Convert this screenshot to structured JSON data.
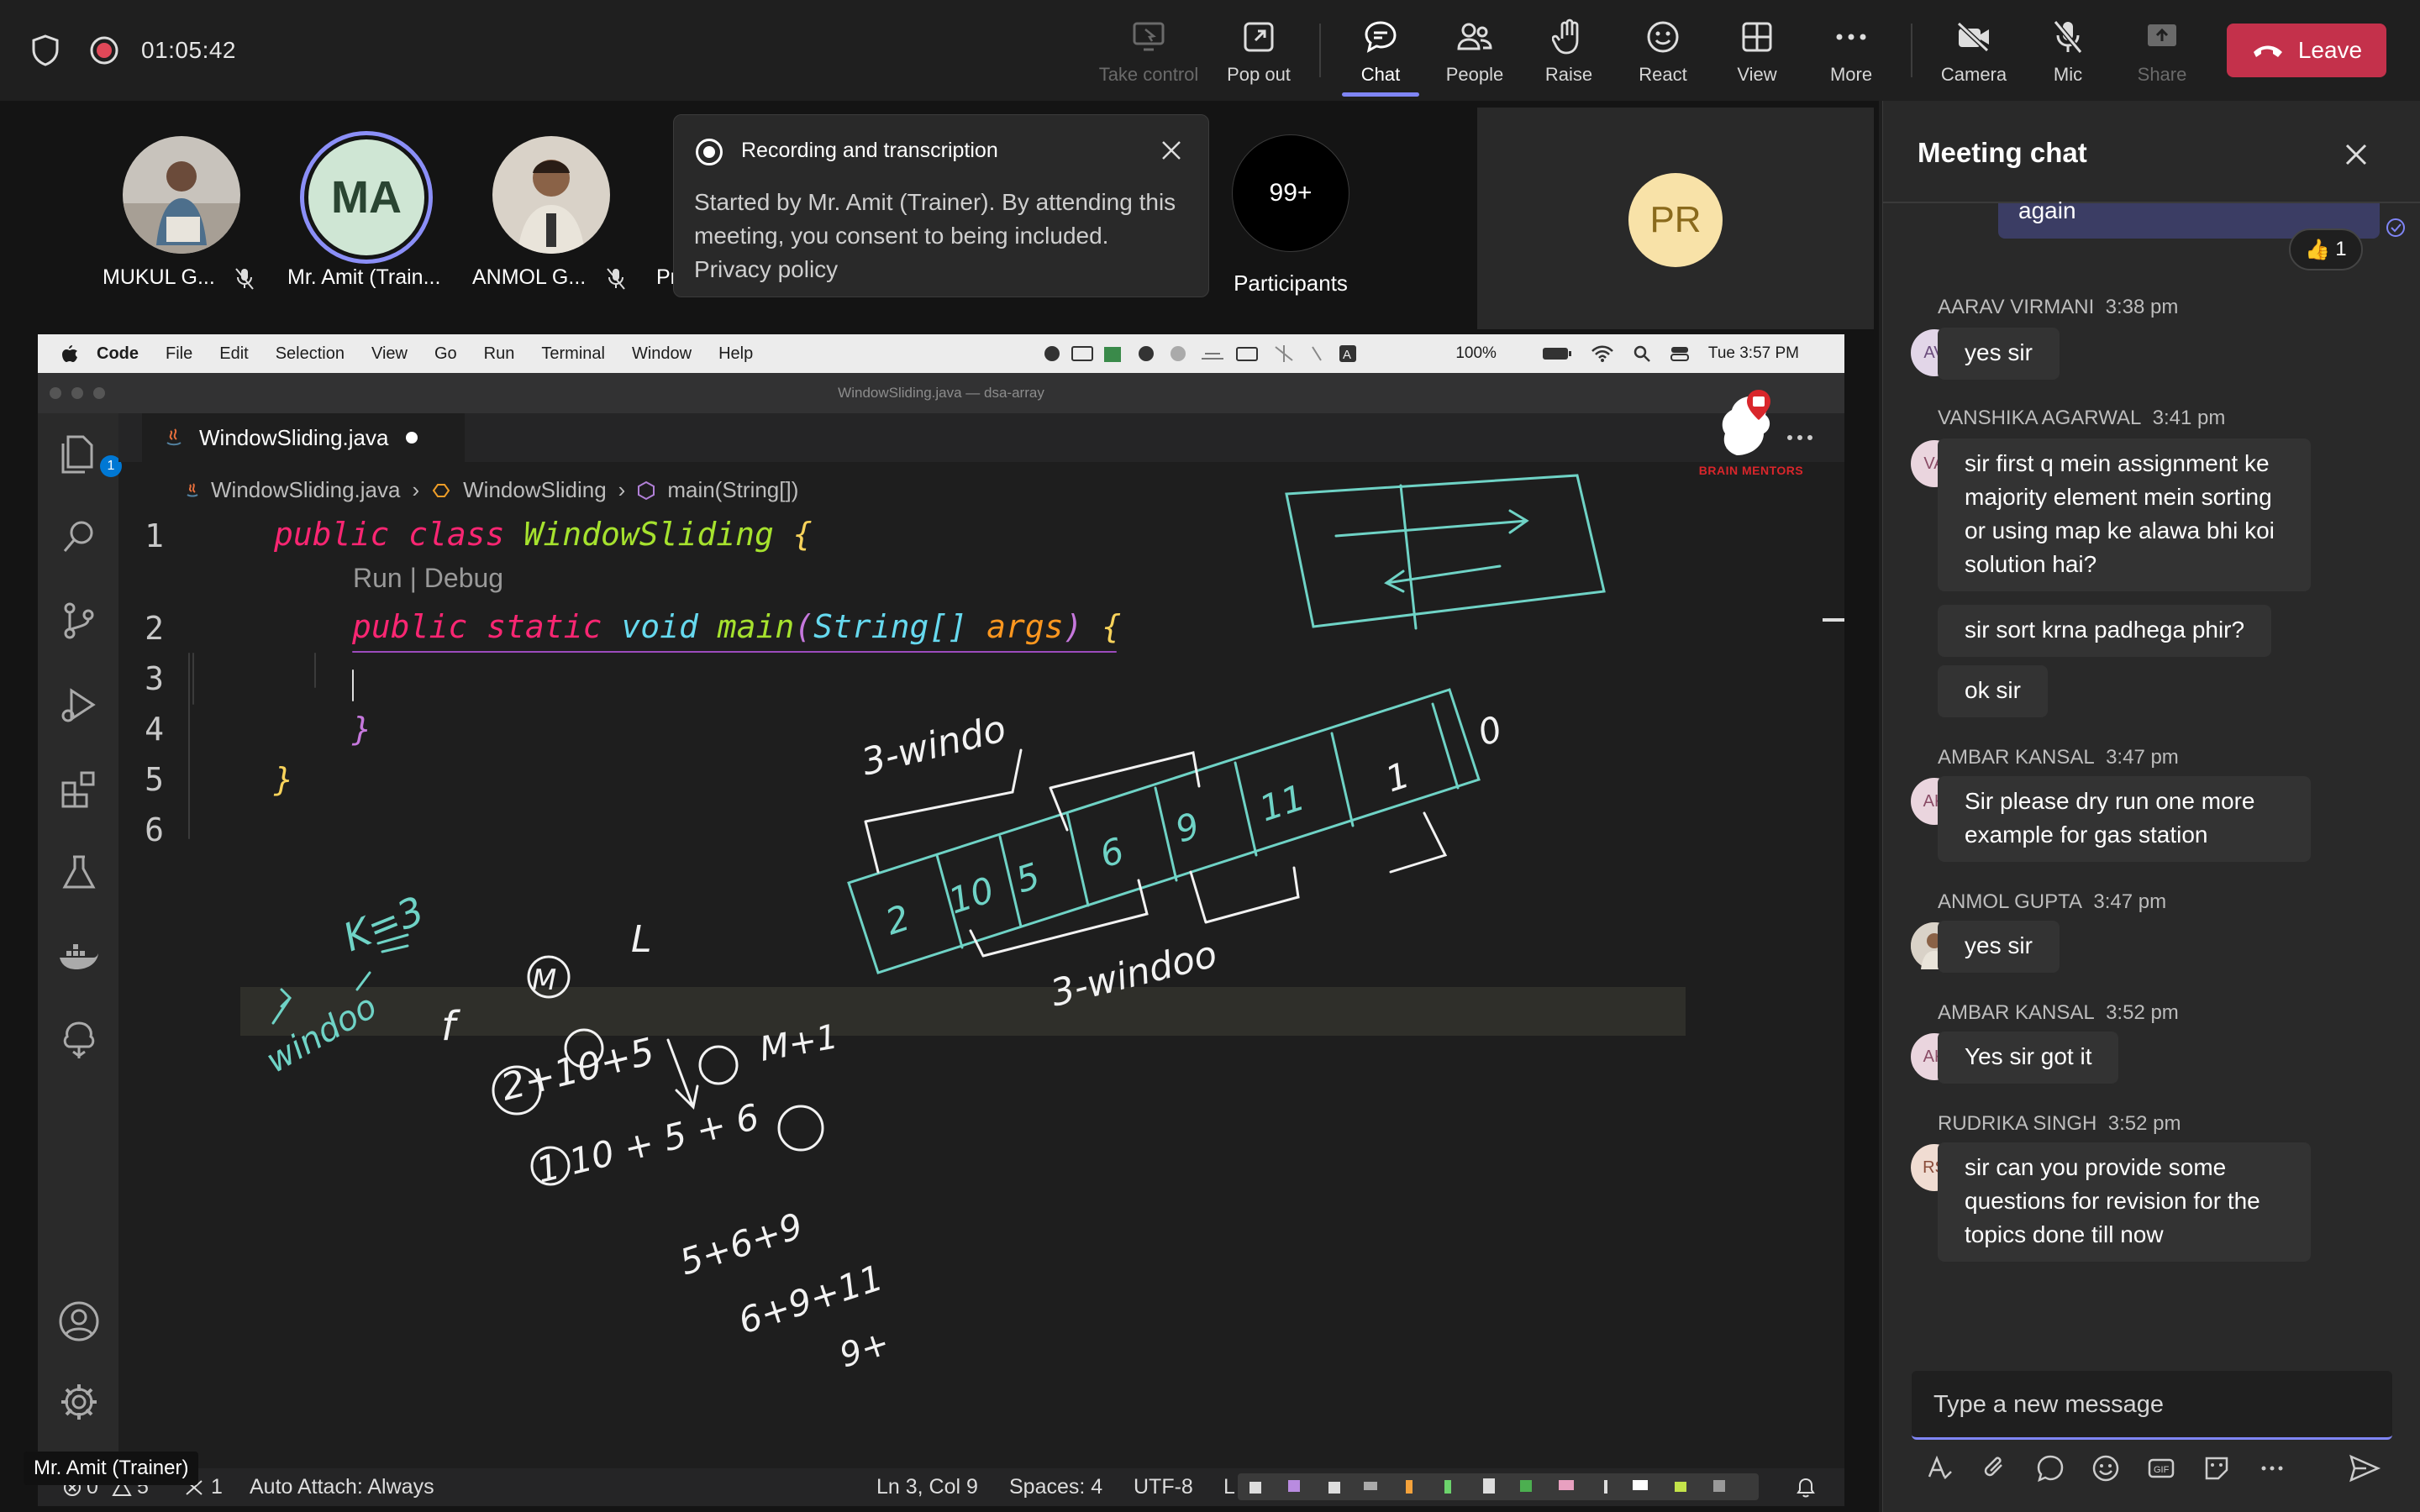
{
  "top_bar": {
    "timer": "01:05:42",
    "buttons": {
      "take_control": "Take control",
      "pop_out": "Pop out",
      "chat": "Chat",
      "people": "People",
      "raise": "Raise",
      "react": "React",
      "view": "View",
      "more": "More",
      "camera": "Camera",
      "mic": "Mic",
      "share": "Share"
    },
    "leave": "Leave"
  },
  "gallery": {
    "participants": [
      {
        "name": "MUKUL G...",
        "muted": true
      },
      {
        "name": "Mr. Amit (Train...",
        "initials": "MA",
        "muted": false
      },
      {
        "name": "ANMOL G...",
        "muted": true
      },
      {
        "name": "Pr"
      }
    ],
    "count": "99+",
    "count_label": "Participants",
    "pr_initials": "PR"
  },
  "toast": {
    "title": "Recording and transcription",
    "body": "Started by Mr. Amit (Trainer). By attending this meeting, you consent to being included.",
    "link": "Privacy policy"
  },
  "shared_screen": {
    "mac_menu": [
      "Code",
      "File",
      "Edit",
      "Selection",
      "View",
      "Go",
      "Run",
      "Terminal",
      "Window",
      "Help"
    ],
    "mac_battery": "100%",
    "mac_clock": "Tue 3:57 PM",
    "window_title": "WindowSliding.java — dsa-array",
    "tab_name": "WindowSliding.java",
    "breadcrumb": [
      "WindowSliding.java",
      "WindowSliding",
      "main(String[])"
    ],
    "brand": "BRAIN MENTORS",
    "line_numbers": [
      "1",
      "2",
      "3",
      "4",
      "5",
      "6"
    ],
    "code_lens": "Run | Debug",
    "code": {
      "l1_kw1": "public",
      "l1_kw2": "class",
      "l1_name": "WindowSliding",
      "l1_brace": "{",
      "l2_kw1": "public",
      "l2_kw2": "static",
      "l2_kw3": "void",
      "l2_fn": "main",
      "l2_open": "(",
      "l2_type": "String[]",
      "l2_arg": "args",
      "l2_close": ")",
      "l2_brace": "{",
      "l4_brace": "}",
      "l5_brace": "}"
    },
    "status_bar": {
      "problems": "0",
      "warnings": "5",
      "ports": "1",
      "auto_attach": "Auto Attach: Always",
      "position": "Ln 3, Col 9",
      "spaces": "Spaces: 4",
      "encoding": "UTF-8",
      "cut_letter": "L"
    },
    "handwriting": {
      "window_label_top": "3-windo",
      "window_label_bottom": "3-windoo",
      "array_cells": [
        "2",
        "10",
        "5",
        "6",
        "9",
        "11",
        "1",
        "0"
      ],
      "k_label": "K=3",
      "side_label": "windoo",
      "expr_f": "f",
      "expr_m": "M",
      "expr_l": "L",
      "expr_mt1": "M+1",
      "expr_a": "2+10+5",
      "expr_b": "1 10 + 5 + 6",
      "expr_c": "5+6+9",
      "expr_d": "6+9+11",
      "expr_e": "9+"
    }
  },
  "presenter_tag": "Mr. Amit (Trainer)",
  "chat": {
    "title": "Meeting chat",
    "self_message_tail": "again",
    "reaction_count": "1",
    "messages": [
      {
        "author": "AARAV VIRMANI",
        "time": "3:38 pm",
        "initials": "AV",
        "texts": [
          "yes sir"
        ]
      },
      {
        "author": "VANSHIKA AGARWAL",
        "time": "3:41 pm",
        "initials": "VA",
        "texts": [
          "sir first q mein assignment ke majority element mein sorting or using map ke alawa bhi koi solution hai?",
          "sir sort krna padhega phir?",
          "ok sir"
        ]
      },
      {
        "author": "AMBAR KANSAL",
        "time": "3:47 pm",
        "initials": "AK",
        "texts": [
          "Sir please dry run one more example for gas station"
        ]
      },
      {
        "author": "ANMOL GUPTA",
        "time": "3:47 pm",
        "initials": "",
        "texts": [
          "yes sir"
        ]
      },
      {
        "author": "AMBAR KANSAL",
        "time": "3:52 pm",
        "initials": "AK",
        "texts": [
          "Yes sir got it"
        ]
      },
      {
        "author": "RUDRIKA SINGH",
        "time": "3:52 pm",
        "initials": "RS",
        "texts": [
          "sir can you provide some questions for revision for the topics done till now"
        ]
      }
    ],
    "compose_placeholder": "Type a new message"
  },
  "colors": {
    "accent": "#7f85f5",
    "leave": "#c4314b",
    "ink": "#ffffff",
    "teal_ink": "#6fd3c6"
  }
}
